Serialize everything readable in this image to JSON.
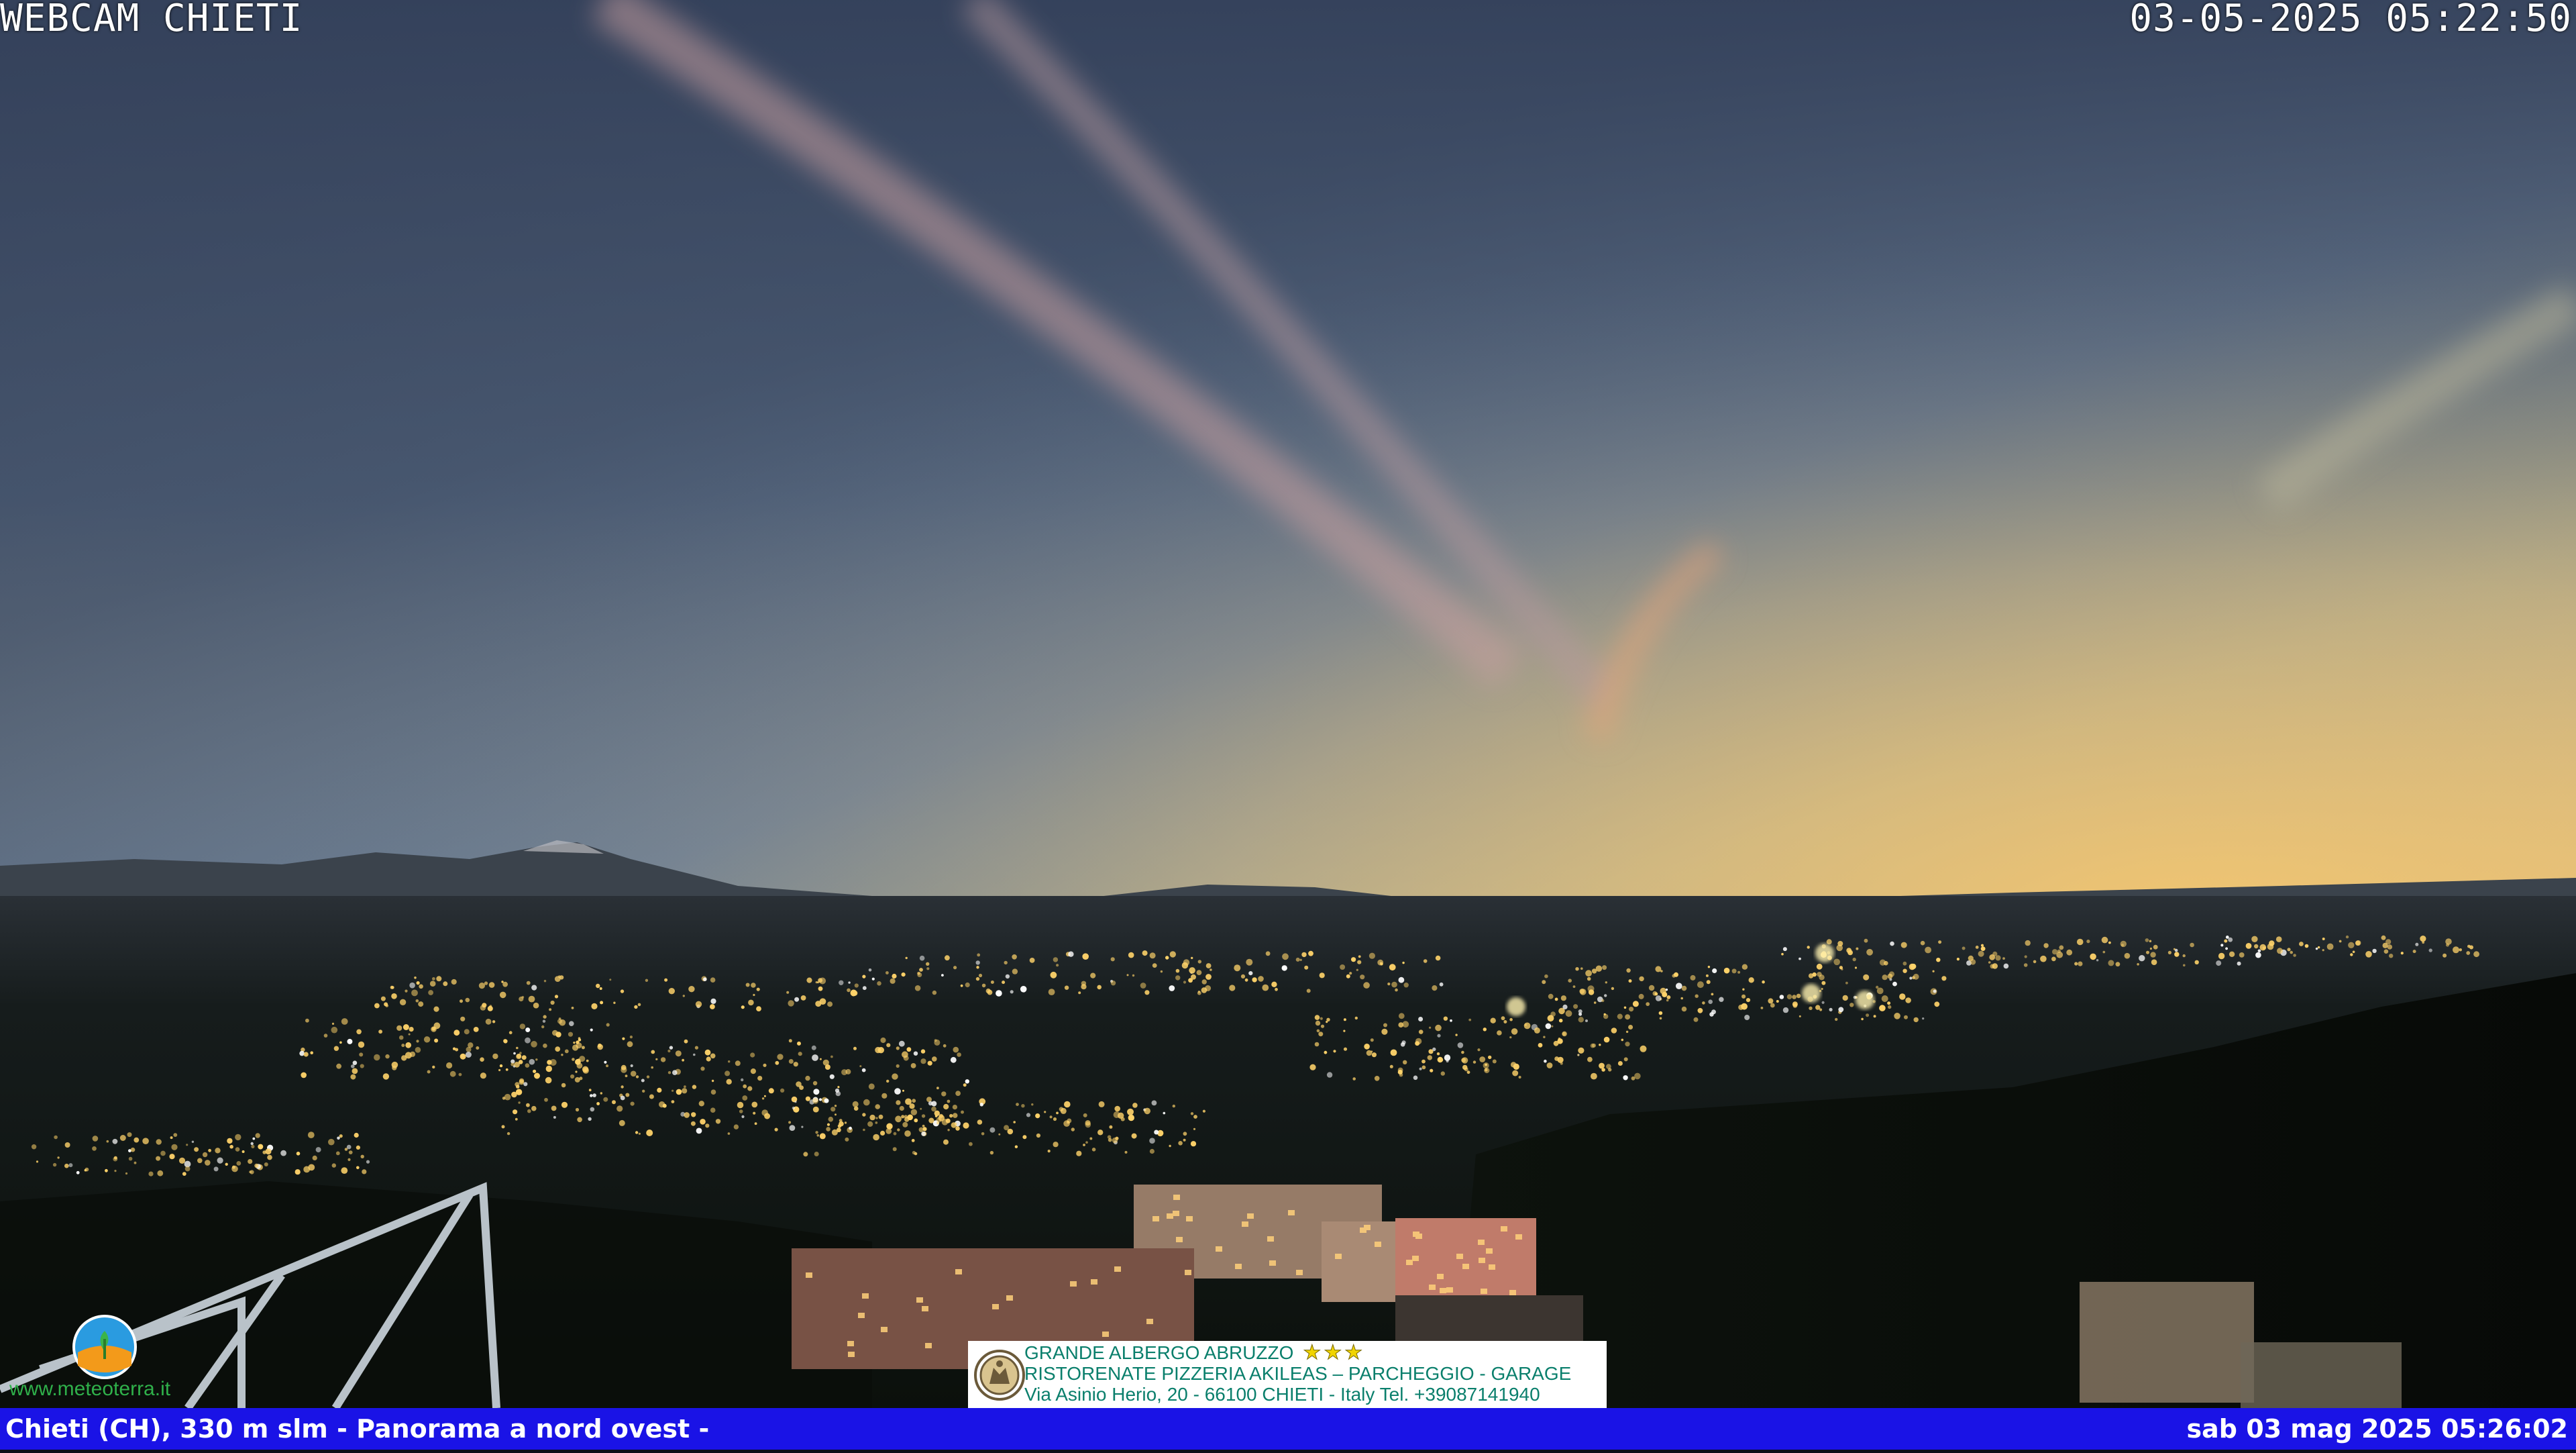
{
  "overlay": {
    "title": "WEBCAM CHIETI",
    "timestamp": "03-05-2025 05:22:50"
  },
  "bottom_bar": {
    "location": "Chieti (CH), 330 m slm - Panorama a nord ovest -",
    "timestamp": "sab 03 mag 2025 05:26:02",
    "color": "#1a13e6"
  },
  "ad": {
    "line1": "GRANDE ALBERGO ABRUZZO",
    "stars": "★★★",
    "line2": "RISTORENATE PIZZERIA AKILEAS – PARCHEGGIO - GARAGE",
    "line3": "Via Asinio Herio, 20 - 66100 CHIETI - Italy Tel. +39087141940",
    "text_color": "#0a7f6c"
  },
  "logo": {
    "url_text": "www.meteoterra.it",
    "icon": "meteo-globe-icon"
  },
  "scene": {
    "sky_top": "#3b4a64",
    "sky_horizon": "#e9c47c",
    "ground": "#0d130d",
    "city_lights": "#ffd36a"
  }
}
